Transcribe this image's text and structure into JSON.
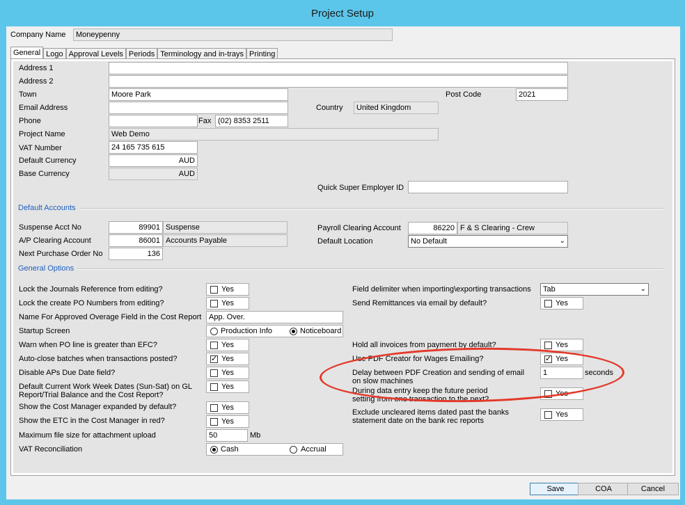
{
  "window": {
    "title": "Project Setup"
  },
  "company": {
    "label": "Company Name",
    "value": "Moneypenny"
  },
  "tabs": [
    "General",
    "Logo",
    "Approval Levels",
    "Periods",
    "Terminology and in-trays",
    "Printing"
  ],
  "general": {
    "address1_label": "Address 1",
    "address1": "",
    "address2_label": "Address 2",
    "address2": "",
    "town_label": "Town",
    "town": "Moore Park",
    "postcode_label": "Post Code",
    "postcode": "2021",
    "email_label": "Email Address",
    "email": "",
    "country_label": "Country",
    "country": "United Kingdom",
    "phone_label": "Phone",
    "phone": "",
    "fax_label": "Fax",
    "fax": "(02) 8353 2511",
    "project_name_label": "Project Name",
    "project_name": "Web Demo",
    "vat_label": "VAT Number",
    "vat": "24 165 735 615",
    "default_currency_label": "Default Currency",
    "default_currency": "AUD",
    "base_currency_label": "Base Currency",
    "base_currency": "AUD",
    "qs_label": "Quick Super Employer ID",
    "qs": ""
  },
  "default_accounts": {
    "heading": "Default Accounts",
    "suspense_label": "Suspense Acct No",
    "suspense_no": "89901",
    "suspense_name": "Suspense",
    "ap_label": "A/P Clearing Account",
    "ap_no": "86001",
    "ap_name": "Accounts Payable",
    "npo_label": "Next Purchase Order No",
    "npo": "136",
    "payroll_label": "Payroll Clearing Account",
    "payroll_no": "86220",
    "payroll_name": "F & S Clearing - Crew",
    "location_label": "Default Location",
    "location": "No Default"
  },
  "general_options": {
    "heading": "General Options",
    "yes": "Yes",
    "lock_journals": "Lock the Journals Reference from editing?",
    "lock_po": "Lock the create PO Numbers from editing?",
    "overage_label": "Name For Approved Overage Field in the Cost Report",
    "overage_value": "App. Over.",
    "startup_label": "Startup Screen",
    "startup_opt1": "Production Info",
    "startup_opt2": "Noticeboard",
    "warn_po": "Warn when PO line is greater than EFC?",
    "auto_close": "Auto-close batches when transactions posted?",
    "disable_due": "Disable APs Due Date field?",
    "work_week_1": "Default Current Work Week Dates (Sun-Sat) on GL",
    "work_week_2": "Report/Trial Balance and the Cost Report?",
    "cost_manager": "Show the Cost Manager expanded by default?",
    "etc_red": "Show the ETC in the Cost Manager in red?",
    "max_file_label": "Maximum file size for attachment upload",
    "max_file": "50",
    "max_file_unit": "Mb",
    "vat_rec_label": "VAT Reconciliation",
    "vat_rec_opt1": "Cash",
    "vat_rec_opt2": "Accrual",
    "delimiter_label": "Field delimiter when importing\\exporting transactions",
    "delimiter": "Tab",
    "remittances": "Send Remittances via email by default?",
    "hold_invoices": "Hold all invoices from payment by default?",
    "pdf_creator": "Use PDF Creator for Wages Emailing?",
    "delay_1": "Delay between PDF Creation and sending of email",
    "delay_2": "on slow machines",
    "delay_value": "1",
    "delay_unit": "seconds",
    "keep_period_1": "During data entry keep the future period",
    "keep_period_2": "setting from one transaction to the next?",
    "exclude_1": "Exclude uncleared items dated past the banks",
    "exclude_2": "statement date on the bank rec reports"
  },
  "buttons": {
    "save": "Save",
    "coa": "COA",
    "cancel": "Cancel"
  },
  "colors": {
    "titlebar": "#5bc6ea",
    "annotation": "#e3392a",
    "section": "#1e5fbf"
  }
}
